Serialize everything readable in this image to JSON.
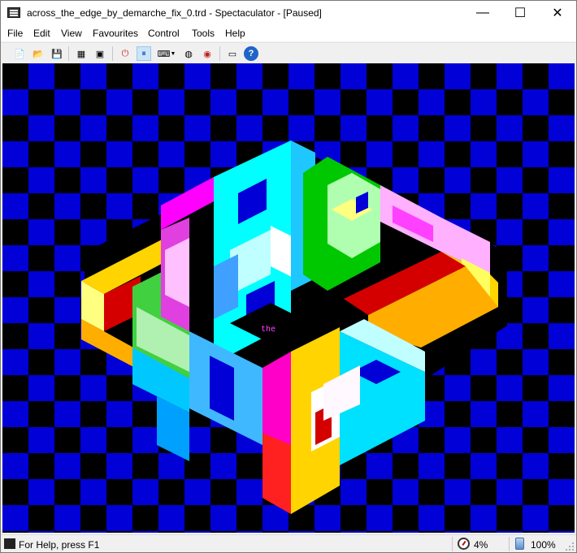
{
  "window": {
    "title": "across_the_edge_by_demarche_fix_0.trd - Spectaculator - [Paused]",
    "controls": {
      "minimize": "—",
      "maximize": "☐",
      "close": "✕"
    }
  },
  "menu": [
    "File",
    "Edit",
    "View",
    "Favourites",
    "Control",
    "Tools",
    "Help"
  ],
  "toolbar": [
    {
      "name": "new-icon",
      "glyph": "📄"
    },
    {
      "name": "open-folder-icon",
      "glyph": "📂"
    },
    {
      "name": "save-icon",
      "glyph": "💾"
    },
    {
      "name": "tape-icon",
      "glyph": "▦"
    },
    {
      "name": "snapshot-icon",
      "glyph": "▣"
    },
    {
      "name": "reset-icon",
      "glyph": "⏻"
    },
    {
      "name": "pause-icon",
      "glyph": "⏸"
    },
    {
      "name": "keyboard-icon",
      "glyph": "⌨"
    },
    {
      "name": "joystick-icon",
      "glyph": "◍"
    },
    {
      "name": "disk-icon",
      "glyph": "◉"
    },
    {
      "name": "zx-spectrum-icon",
      "glyph": "▭"
    },
    {
      "name": "help-icon",
      "glyph": "?"
    }
  ],
  "screen": {
    "caption": "the",
    "colors": {
      "blue": "#0000d7",
      "black": "#000000"
    }
  },
  "status": {
    "help": "For Help, press F1",
    "speed": "4%",
    "zoom": "100%"
  }
}
